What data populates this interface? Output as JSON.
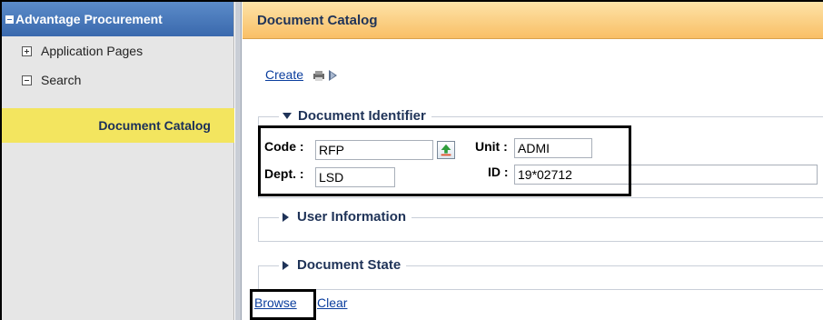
{
  "sidebar": {
    "title": "Advantage Procurement",
    "items": [
      {
        "label": "Application Pages",
        "toggle": "plus"
      },
      {
        "label": "Search",
        "toggle": "minus"
      }
    ],
    "active_item": "Document Catalog"
  },
  "main": {
    "title": "Document Catalog",
    "create_label": "Create",
    "sections": {
      "document_identifier": {
        "legend": "Document Identifier",
        "expanded": true,
        "fields": {
          "code": {
            "label": "Code :",
            "value": "RFP"
          },
          "unit": {
            "label": "Unit :",
            "value": "ADMI"
          },
          "dept": {
            "label": "Dept. :",
            "value": "LSD"
          },
          "id": {
            "label": "ID :",
            "value": "19*02712"
          }
        }
      },
      "user_information": {
        "legend": "User Information",
        "expanded": false
      },
      "document_state": {
        "legend": "Document State",
        "expanded": false
      }
    },
    "actions": {
      "browse_label": "Browse",
      "clear_label": "Clear"
    }
  },
  "colors": {
    "sidebar_header": "#3a69ad",
    "active_item_bg": "#f3e55f",
    "main_header_bg": "#f9bf66",
    "link": "#0b3e9e"
  }
}
